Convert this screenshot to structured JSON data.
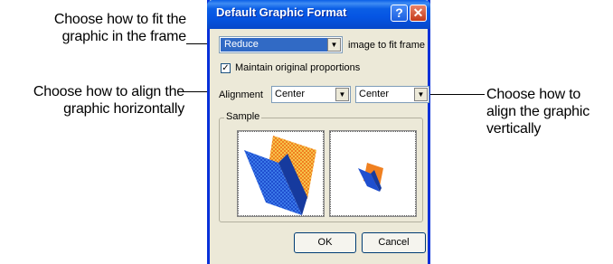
{
  "callouts": {
    "fit": [
      "Choose how to fit the",
      "graphic in the frame"
    ],
    "horizontal": [
      "Choose how to align the",
      "graphic horizontally"
    ],
    "vertical": [
      "Choose how to",
      "align the graphic",
      "vertically"
    ]
  },
  "dialog": {
    "title": "Default Graphic Format",
    "help_symbol": "?",
    "close_symbol": "✕",
    "fit_select": "Reduce",
    "fit_suffix": "image to fit frame",
    "maintain_label": "Maintain original proportions",
    "maintain_checked": true,
    "alignment_label": "Alignment",
    "align_horizontal": "Center",
    "align_vertical": "Center",
    "sample_label": "Sample",
    "ok_label": "OK",
    "cancel_label": "Cancel"
  },
  "colors": {
    "folder_blue": "#1f4fcf",
    "folder_orange": "#f08020",
    "title_blue": "#0a5ee6"
  }
}
